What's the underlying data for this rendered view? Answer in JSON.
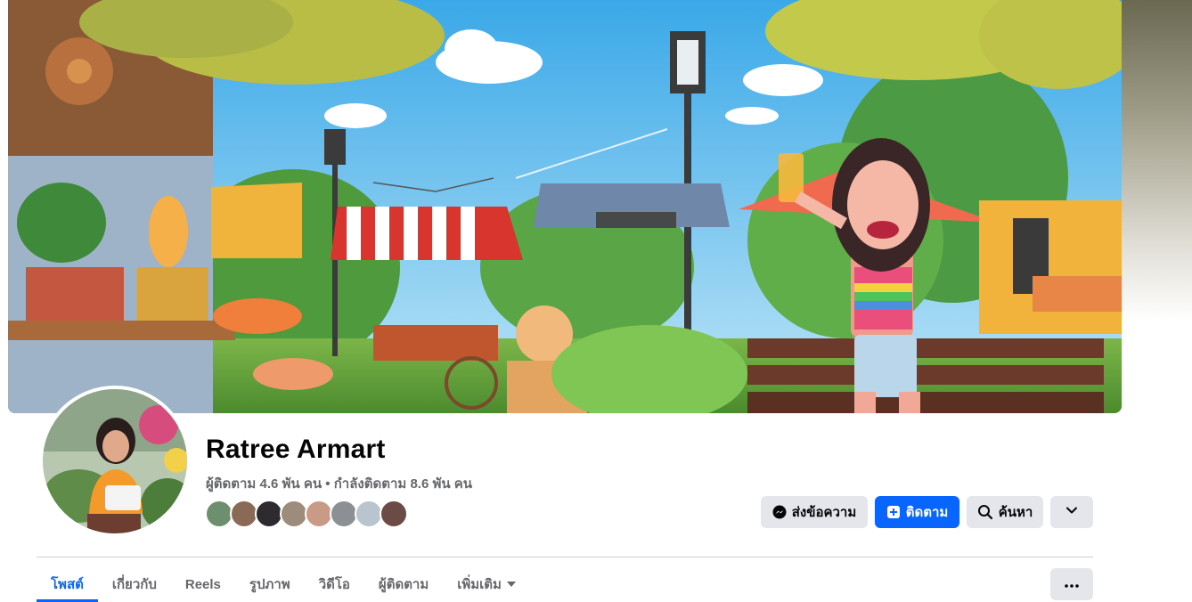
{
  "profile": {
    "name": "Ratree Armart",
    "followers_text": "ผู้ติดตาม 4.6 พัน คน",
    "separator": "•",
    "following_text": "กำลังติดตาม 8.6 พัน คน"
  },
  "friend_avatars": [
    "friend-1",
    "friend-2",
    "friend-3",
    "friend-4",
    "friend-5",
    "friend-6",
    "friend-7",
    "friend-8"
  ],
  "actions": {
    "message_label": "ส่งข้อความ",
    "follow_label": "ติดตาม",
    "search_label": "ค้นหา",
    "message_icon": "messenger-icon",
    "follow_icon": "follow-plus-icon",
    "search_icon": "search-icon",
    "dropdown_icon": "chevron-down-icon"
  },
  "tabs": {
    "posts": "โพสต์",
    "about": "เกี่ยวกับ",
    "reels": "Reels",
    "photos": "รูปภาพ",
    "videos": "วิดีโอ",
    "followers": "ผู้ติดตาม",
    "more": "เพิ่มเติม",
    "more_icon": "caret-down-icon",
    "overflow_icon": "ellipsis-icon"
  },
  "colors": {
    "accent": "#0866ff",
    "button_gray": "#e4e6eb",
    "text_secondary": "#65676b"
  }
}
